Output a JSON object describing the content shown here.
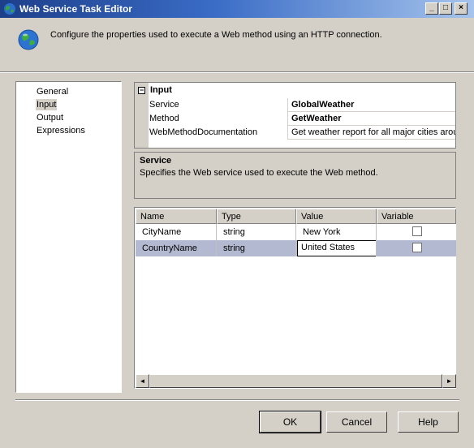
{
  "window": {
    "title": "Web Service Task Editor",
    "controls": {
      "minimize": "_",
      "maximize": "□",
      "close": "×"
    }
  },
  "header": {
    "icon": "globe-icon",
    "description": "Configure the properties used to execute a Web method using an HTTP connection."
  },
  "nav": {
    "items": [
      {
        "label": "General",
        "selected": false
      },
      {
        "label": "Input",
        "selected": true
      },
      {
        "label": "Output",
        "selected": false
      },
      {
        "label": "Expressions",
        "selected": false
      }
    ]
  },
  "properties": {
    "category": "Input",
    "toggle": "−",
    "rows": [
      {
        "name": "Service",
        "value": "GlobalWeather"
      },
      {
        "name": "Method",
        "value": "GetWeather"
      },
      {
        "name": "WebMethodDocumentation",
        "value": "Get weather report for all major cities arou"
      }
    ]
  },
  "description_panel": {
    "title": "Service",
    "text": "Specifies the Web service used to execute the Web method."
  },
  "table": {
    "columns": [
      "Name",
      "Type",
      "Value",
      "Variable"
    ],
    "rows": [
      {
        "name": "CityName",
        "type": "string",
        "value": "New York",
        "variable": false
      },
      {
        "name": "CountryName",
        "type": "string",
        "value": "United States",
        "variable": false
      }
    ],
    "scroll_left": "◄",
    "scroll_right": "►"
  },
  "buttons": {
    "ok": "OK",
    "cancel": "Cancel",
    "help": "Help"
  },
  "colors": {
    "selected_row": "#b3b9d1",
    "titlebar": "#1d3f8a"
  }
}
